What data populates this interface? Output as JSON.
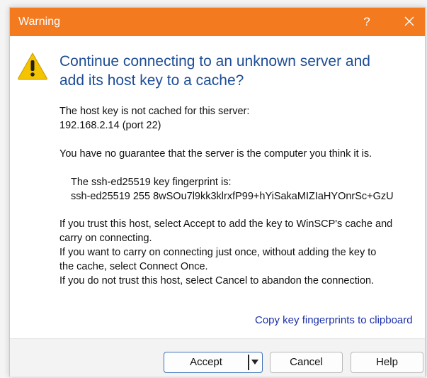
{
  "window": {
    "title": "Warning",
    "help_glyph": "?",
    "titlebar_color": "#f47a1f"
  },
  "dialog": {
    "heading_line1": "Continue connecting to an unknown server and",
    "heading_line2": "add its host key to a cache?",
    "para1_line1": "The host key is not cached for this server:",
    "para1_line2": "192.168.2.14 (port 22)",
    "para2": "You have no guarantee that the server is the computer you think it is.",
    "fingerprint_label": "The ssh-ed25519 key fingerprint is:",
    "fingerprint_value": "ssh-ed25519 255 8wSOu7l9kk3klrxfP99+hYiSakaMIZIaHYOnrSc+GzU",
    "instr_line1": "If you trust this host, select Accept to add the key to WinSCP's cache and",
    "instr_line2": "carry on connecting.",
    "instr_line3": "If you want to carry on connecting just once, without adding the key to",
    "instr_line4": "the cache, select Connect Once.",
    "instr_line5": "If you do not trust this host, select Cancel to abandon the connection.",
    "copy_link": "Copy key fingerprints to clipboard"
  },
  "buttons": {
    "accept": "Accept",
    "cancel": "Cancel",
    "help": "Help"
  },
  "icons": {
    "warning": "warning-triangle-icon",
    "close": "close-icon",
    "dropdown": "caret-down-icon"
  },
  "colors": {
    "heading": "#1d4d96",
    "link": "#1a2fa8",
    "warning_yellow": "#f5c400"
  }
}
